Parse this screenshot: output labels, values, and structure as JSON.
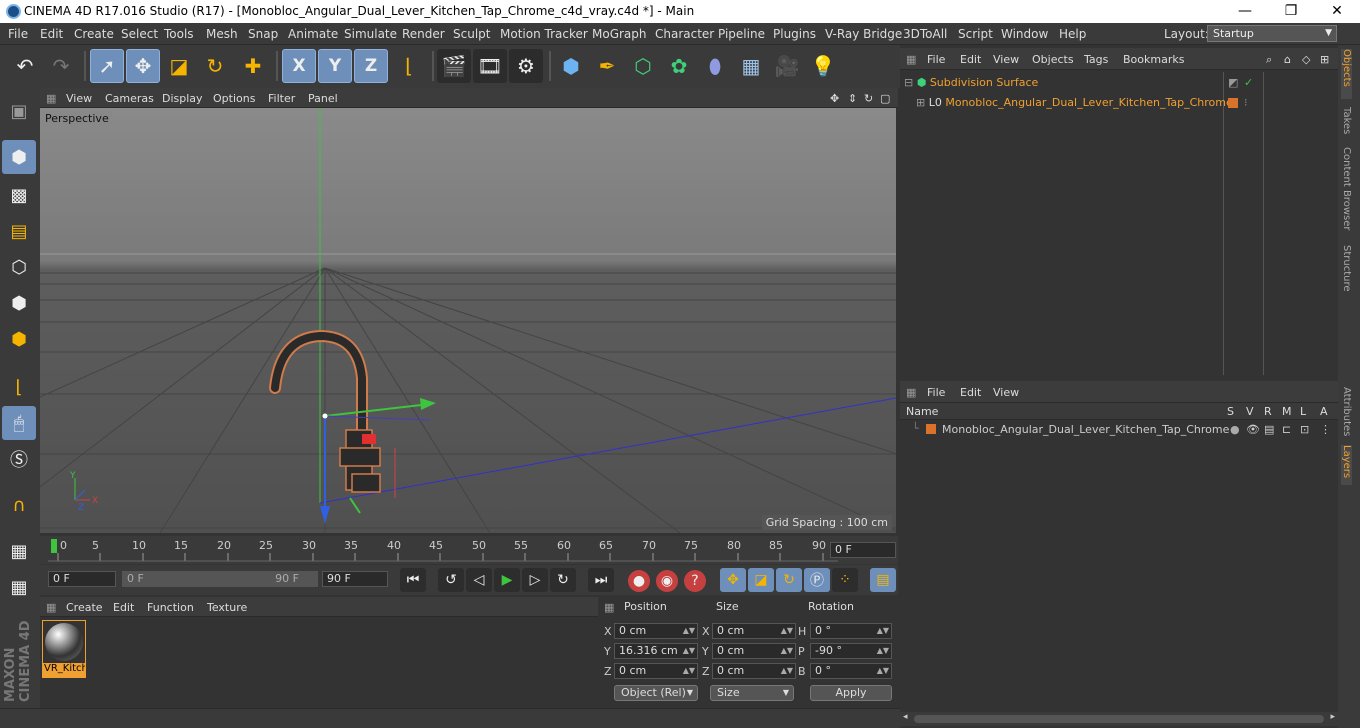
{
  "window": {
    "title": "CINEMA 4D R17.016 Studio (R17) - [Monobloc_Angular_Dual_Lever_Kitchen_Tap_Chrome_c4d_vray.c4d *] - Main",
    "min": "—",
    "max": "❐",
    "close": "✕"
  },
  "menubar": {
    "items": [
      "File",
      "Edit",
      "Create",
      "Select",
      "Tools",
      "Mesh",
      "Snap",
      "Animate",
      "Simulate",
      "Render",
      "Sculpt",
      "Motion Tracker",
      "MoGraph",
      "Character",
      "Pipeline",
      "Plugins",
      "V-Ray Bridge",
      "3DToAll",
      "Script",
      "Window",
      "Help"
    ],
    "layout_label": "Layout:",
    "layout_value": "Startup"
  },
  "toolbar": {
    "axis_x": "X",
    "axis_y": "Y",
    "axis_z": "Z"
  },
  "viewport": {
    "menu": [
      "View",
      "Cameras",
      "Display",
      "Options",
      "Filter",
      "Panel"
    ],
    "label": "Perspective",
    "grid_spacing": "Grid Spacing : 100 cm",
    "axis_x": "X",
    "axis_y": "Y",
    "axis_z": "Z"
  },
  "timeline": {
    "ticks": [
      "0",
      "5",
      "10",
      "15",
      "20",
      "25",
      "30",
      "35",
      "40",
      "45",
      "50",
      "55",
      "60",
      "65",
      "70",
      "75",
      "80",
      "85",
      "90"
    ],
    "current_frame": "0 F"
  },
  "anim": {
    "start_frame": "0 F",
    "range_start": "0 F",
    "range_end": "90 F",
    "end_frame": "90 F"
  },
  "materials": {
    "menu": [
      "Create",
      "Edit",
      "Function",
      "Texture"
    ],
    "items": [
      {
        "label": "VR_Kitch"
      }
    ]
  },
  "attributes": {
    "headers": {
      "position": "Position",
      "size": "Size",
      "rotation": "Rotation"
    },
    "rows": [
      {
        "pos_label": "X",
        "pos_value": "0 cm",
        "size_label": "X",
        "size_value": "0 cm",
        "rot_label": "H",
        "rot_value": "0 °"
      },
      {
        "pos_label": "Y",
        "pos_value": "16.316 cm",
        "size_label": "Y",
        "size_value": "0 cm",
        "rot_label": "P",
        "rot_value": "-90 °"
      },
      {
        "pos_label": "Z",
        "pos_value": "0 cm",
        "size_label": "Z",
        "size_value": "0 cm",
        "rot_label": "B",
        "rot_value": "0 °"
      }
    ],
    "coord_mode": "Object (Rel)",
    "size_mode": "Size",
    "apply": "Apply"
  },
  "objects_panel": {
    "menu": [
      "File",
      "Edit",
      "View",
      "Objects",
      "Tags",
      "Bookmarks"
    ],
    "items": [
      {
        "name": "Subdivision Surface"
      },
      {
        "name": "Monobloc_Angular_Dual_Lever_Kitchen_Tap_Chrome"
      }
    ]
  },
  "layers_panel": {
    "menu": [
      "File",
      "Edit",
      "View"
    ],
    "columns": {
      "name": "Name",
      "s": "S",
      "v": "V",
      "r": "R",
      "m": "M",
      "l": "L",
      "a": "A"
    },
    "items": [
      {
        "name": "Monobloc_Angular_Dual_Lever_Kitchen_Tap_Chrome",
        "color": "#d9722a"
      }
    ]
  },
  "side_tabs": [
    "Objects",
    "Takes",
    "Content Browser",
    "Structure",
    "Attributes",
    "Layers"
  ],
  "branding": {
    "maxon": "MAXON",
    "cinema": "CINEMA 4D"
  },
  "colors": {
    "accent": "#6d8fba",
    "orange": "#f0a030",
    "layer": "#d9722a"
  }
}
